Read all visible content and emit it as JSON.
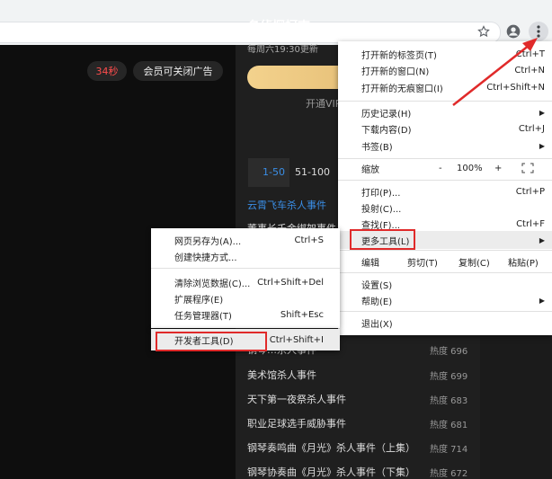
{
  "browser": {
    "star_icon": "star-icon",
    "profile_icon": "account-icon",
    "menu_icon": "kebab-icon"
  },
  "player": {
    "countdown": "34秒",
    "ad_close": "会员可关闭广告"
  },
  "show": {
    "title": "名侦探柯南",
    "schedule": "每周六19:30更新",
    "vip_text": "开通VIP",
    "tabs": [
      "1-50",
      "51-100"
    ],
    "episodes": [
      {
        "title": "云霄飞车杀人事件",
        "heat": ""
      },
      {
        "title": "董事长千金绑架事件",
        "heat": ""
      },
      {
        "title": "钢琴…杀人事件",
        "heat": "热度 696"
      },
      {
        "title": "美术馆杀人事件",
        "heat": "热度 699"
      },
      {
        "title": "天下第一夜祭杀人事件",
        "heat": "热度 683"
      },
      {
        "title": "职业足球选手威胁事件",
        "heat": "热度 681"
      },
      {
        "title": "钢琴奏鸣曲《月光》杀人事件（上集）",
        "heat": "热度 714"
      },
      {
        "title": "钢琴协奏曲《月光》杀人事件（下集）",
        "heat": "热度 672"
      }
    ]
  },
  "chrome_menu": {
    "new_tab": {
      "label": "打开新的标签页(T)",
      "shortcut": "Ctrl+T"
    },
    "new_window": {
      "label": "打开新的窗口(N)",
      "shortcut": "Ctrl+N"
    },
    "incognito": {
      "label": "打开新的无痕窗口(I)",
      "shortcut": "Ctrl+Shift+N"
    },
    "history": {
      "label": "历史记录(H)"
    },
    "downloads": {
      "label": "下载内容(D)",
      "shortcut": "Ctrl+J"
    },
    "bookmarks": {
      "label": "书签(B)"
    },
    "zoom": {
      "label": "缩放",
      "minus": "-",
      "value": "100%",
      "plus": "+"
    },
    "print": {
      "label": "打印(P)...",
      "shortcut": "Ctrl+P"
    },
    "cast": {
      "label": "投射(C)..."
    },
    "find": {
      "label": "查找(F)...",
      "shortcut": "Ctrl+F"
    },
    "more_tools": {
      "label": "更多工具(L)"
    },
    "edit": {
      "label": "编辑",
      "cut": "剪切(T)",
      "copy": "复制(C)",
      "paste": "粘贴(P)"
    },
    "settings": {
      "label": "设置(S)"
    },
    "help": {
      "label": "帮助(E)"
    },
    "exit": {
      "label": "退出(X)"
    }
  },
  "submenu": {
    "save_page": {
      "label": "网页另存为(A)...",
      "shortcut": "Ctrl+S"
    },
    "shortcut": {
      "label": "创建快捷方式..."
    },
    "clear_data": {
      "label": "清除浏览数据(C)...",
      "shortcut": "Ctrl+Shift+Del"
    },
    "extensions": {
      "label": "扩展程序(E)"
    },
    "task_manager": {
      "label": "任务管理器(T)",
      "shortcut": "Shift+Esc"
    },
    "dev_tools": {
      "label": "开发者工具(D)",
      "shortcut": "Ctrl+Shift+I"
    }
  },
  "colors": {
    "highlight_red": "#e02a2a",
    "episode_blue": "#3a8ee6",
    "countdown_red": "#ff4d4d"
  }
}
